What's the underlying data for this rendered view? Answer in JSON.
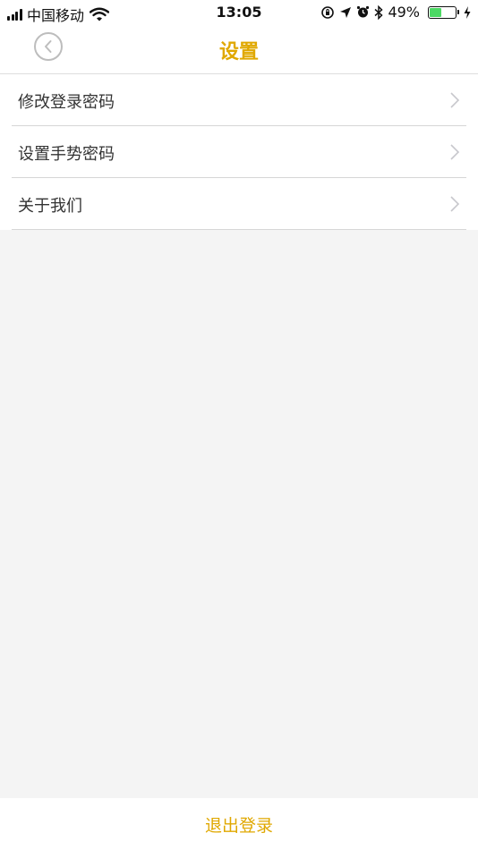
{
  "status_bar": {
    "carrier": "中国移动",
    "time": "13:05",
    "battery": "49%",
    "battery_level": 0.49,
    "icons": [
      "signal-icon",
      "wifi-icon",
      "orientation-lock-icon",
      "location-icon",
      "alarm-icon",
      "bluetooth-icon",
      "battery-icon",
      "charging-icon"
    ]
  },
  "nav": {
    "title": "设置",
    "back_icon": "back-chevron-icon"
  },
  "menu": {
    "items": [
      {
        "label": "修改登录密码"
      },
      {
        "label": "设置手势密码"
      },
      {
        "label": "关于我们"
      }
    ]
  },
  "footer": {
    "logout_label": "退出登录"
  },
  "colors": {
    "accent": "#e0a800",
    "background": "#f4f4f4",
    "battery_green": "#4cd964"
  }
}
